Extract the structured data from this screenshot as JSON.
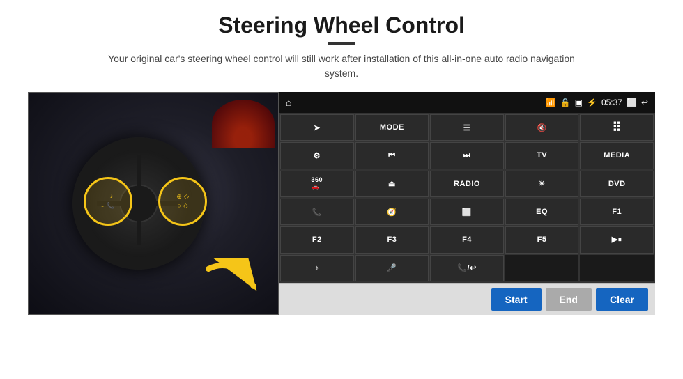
{
  "page": {
    "title": "Steering Wheel Control",
    "subtitle": "Your original car's steering wheel control will still work after installation of this all-in-one auto radio navigation system."
  },
  "status_bar": {
    "time": "05:37"
  },
  "panel_buttons": [
    {
      "id": "btn-nav",
      "label": "➤",
      "icon": true
    },
    {
      "id": "btn-mode",
      "label": "MODE",
      "icon": false
    },
    {
      "id": "btn-list",
      "label": "☰",
      "icon": true
    },
    {
      "id": "btn-mute",
      "label": "🔇",
      "icon": true
    },
    {
      "id": "btn-apps",
      "label": "⠿",
      "icon": true
    },
    {
      "id": "btn-settings",
      "label": "⚙",
      "icon": true
    },
    {
      "id": "btn-prev",
      "label": "⏮",
      "icon": true
    },
    {
      "id": "btn-next",
      "label": "⏭",
      "icon": true
    },
    {
      "id": "btn-tv",
      "label": "TV",
      "icon": false
    },
    {
      "id": "btn-media",
      "label": "MEDIA",
      "icon": false
    },
    {
      "id": "btn-360",
      "label": "360",
      "icon": false
    },
    {
      "id": "btn-eject",
      "label": "⏏",
      "icon": true
    },
    {
      "id": "btn-radio",
      "label": "RADIO",
      "icon": false
    },
    {
      "id": "btn-bright",
      "label": "☀",
      "icon": true
    },
    {
      "id": "btn-dvd",
      "label": "DVD",
      "icon": false
    },
    {
      "id": "btn-phone",
      "label": "📞",
      "icon": true
    },
    {
      "id": "btn-navi",
      "label": "🧭",
      "icon": true
    },
    {
      "id": "btn-screen",
      "label": "⬜",
      "icon": true
    },
    {
      "id": "btn-eq",
      "label": "EQ",
      "icon": false
    },
    {
      "id": "btn-f1",
      "label": "F1",
      "icon": false
    },
    {
      "id": "btn-f2",
      "label": "F2",
      "icon": false
    },
    {
      "id": "btn-f3",
      "label": "F3",
      "icon": false
    },
    {
      "id": "btn-f4",
      "label": "F4",
      "icon": false
    },
    {
      "id": "btn-f5",
      "label": "F5",
      "icon": false
    },
    {
      "id": "btn-playpause",
      "label": "▶⏸",
      "icon": true
    },
    {
      "id": "btn-music",
      "label": "♪",
      "icon": true
    },
    {
      "id": "btn-mic",
      "label": "🎤",
      "icon": true
    },
    {
      "id": "btn-call",
      "label": "📞/↩",
      "icon": true
    }
  ],
  "bottom_bar": {
    "start_label": "Start",
    "end_label": "End",
    "clear_label": "Clear"
  }
}
